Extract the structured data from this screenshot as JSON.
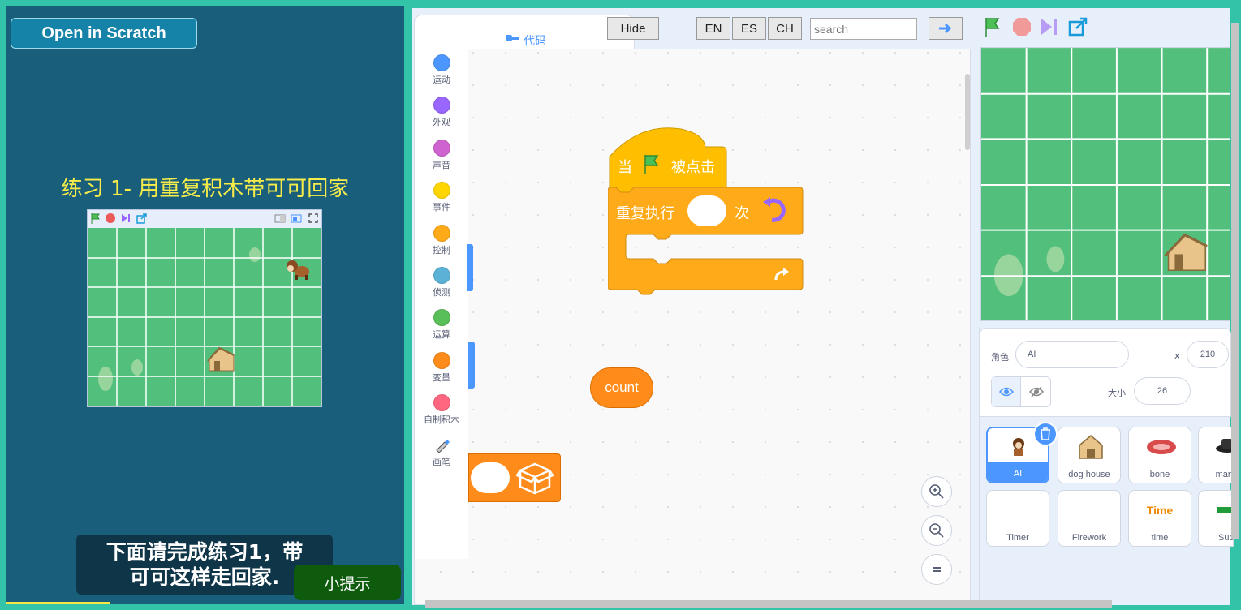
{
  "left_panel": {
    "open_button": "Open in Scratch",
    "lesson_title": "练习 1- 用重复积木带可可回家",
    "hint_text_line1": "下面请完成练习1，带",
    "hint_text_line2": "可可这样走回家.",
    "tip_button": "小提示"
  },
  "editor": {
    "code_tab": "代码",
    "hide_button": "Hide",
    "lang_en": "EN",
    "lang_es": "ES",
    "lang_ch": "CH",
    "search_placeholder": "search",
    "categories": [
      {
        "label": "运动",
        "color": "#4c97ff"
      },
      {
        "label": "外观",
        "color": "#9966ff"
      },
      {
        "label": "声音",
        "color": "#cf63cf"
      },
      {
        "label": "事件",
        "color": "#ffd500"
      },
      {
        "label": "控制",
        "color": "#ffab19"
      },
      {
        "label": "侦测",
        "color": "#5cb1d6"
      },
      {
        "label": "运算",
        "color": "#59c059"
      },
      {
        "label": "变量",
        "color": "#ff8c1a"
      },
      {
        "label": "自制积木",
        "color": "#ff6680"
      },
      {
        "label": "画笔",
        "color": "#0fbd8c"
      }
    ],
    "blocks": {
      "hat_when": "当",
      "hat_clicked": "被点击",
      "repeat_label": "重复执行",
      "repeat_unit": "次",
      "variable": "count"
    }
  },
  "sprite_info": {
    "sprite_label": "角色",
    "sprite_name": "AI",
    "x_label": "x",
    "x_value": "210",
    "size_label": "大小",
    "size_value": "26"
  },
  "sprites": [
    {
      "name": "AI"
    },
    {
      "name": "dog house"
    },
    {
      "name": "bone"
    },
    {
      "name": "man"
    },
    {
      "name": "Timer"
    },
    {
      "name": "Firework"
    },
    {
      "name": "time",
      "preview_text": "Time"
    },
    {
      "name": "Suc"
    }
  ]
}
